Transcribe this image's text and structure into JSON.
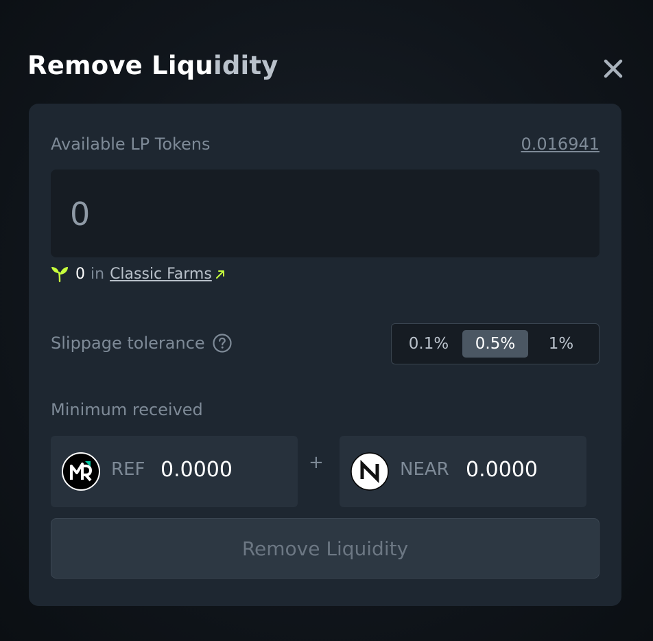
{
  "modal": {
    "title_main": "Remove Liqu",
    "title_tail": "idity",
    "close_icon": "close-icon"
  },
  "lp": {
    "label": "Available LP Tokens",
    "balance": "0.016941",
    "amount_value": "0",
    "amount_placeholder": "0"
  },
  "farms": {
    "icon": "sprout-icon",
    "count": "0",
    "in_text": "in",
    "link_label": "Classic Farms",
    "link_icon": "external-arrow-icon"
  },
  "slippage": {
    "label": "Slippage tolerance",
    "help_icon": "question-circle-icon",
    "options": [
      "0.1%",
      "0.5%",
      "1%"
    ],
    "selected": "0.5%"
  },
  "minimum": {
    "label": "Minimum received",
    "plus": "+",
    "tokens": [
      {
        "symbol": "REF",
        "amount": "0.0000",
        "icon": "ref-token-icon"
      },
      {
        "symbol": "NEAR",
        "amount": "0.0000",
        "icon": "near-token-icon"
      }
    ]
  },
  "submit": {
    "label": "Remove Liquidity"
  },
  "colors": {
    "card_bg": "#1e2731",
    "input_bg": "#161c23",
    "accent_green": "#c7ff3d",
    "active_option_bg": "#4b5763"
  }
}
